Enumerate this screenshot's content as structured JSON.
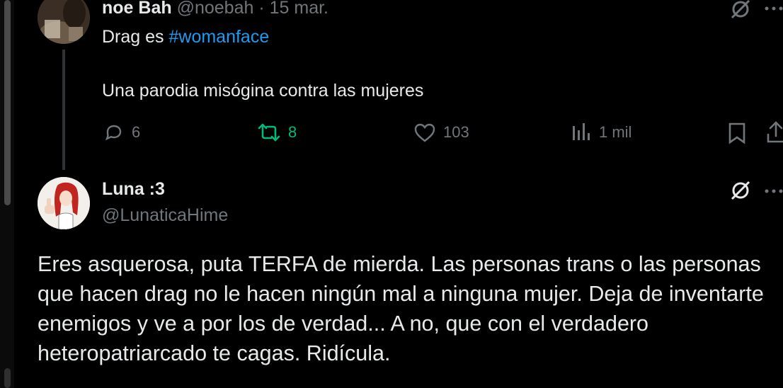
{
  "tweet1": {
    "display_name": "noe Bah",
    "handle": "@noebah",
    "separator": "·",
    "date": "15 mar.",
    "line1_prefix": "Drag es ",
    "hashtag": "#womanface",
    "line2": "Una parodia misógina contra las mujeres",
    "replies": "6",
    "retweets": "8",
    "likes": "103",
    "views": "1 mil"
  },
  "tweet2": {
    "display_name": "Luna :3",
    "handle": "@LunaticaHime",
    "text": "Eres asquerosa, puta TERFA de mierda. Las personas trans o las personas que hacen drag no le hacen ningún mal a ninguna mujer. Deja de inventarte enemigos y ve a por los de verdad... A no, que con el verdadero heteropatriarcado te cagas. Ridícula."
  },
  "colors": {
    "background": "#000000",
    "text": "#e7e9ea",
    "muted": "#71767b",
    "link": "#1d9bf0",
    "retweet": "#00ba7c"
  },
  "icons": [
    "grok-icon",
    "more-icon",
    "reply-icon",
    "retweet-icon",
    "like-icon",
    "views-icon",
    "bookmark-icon",
    "share-icon"
  ]
}
